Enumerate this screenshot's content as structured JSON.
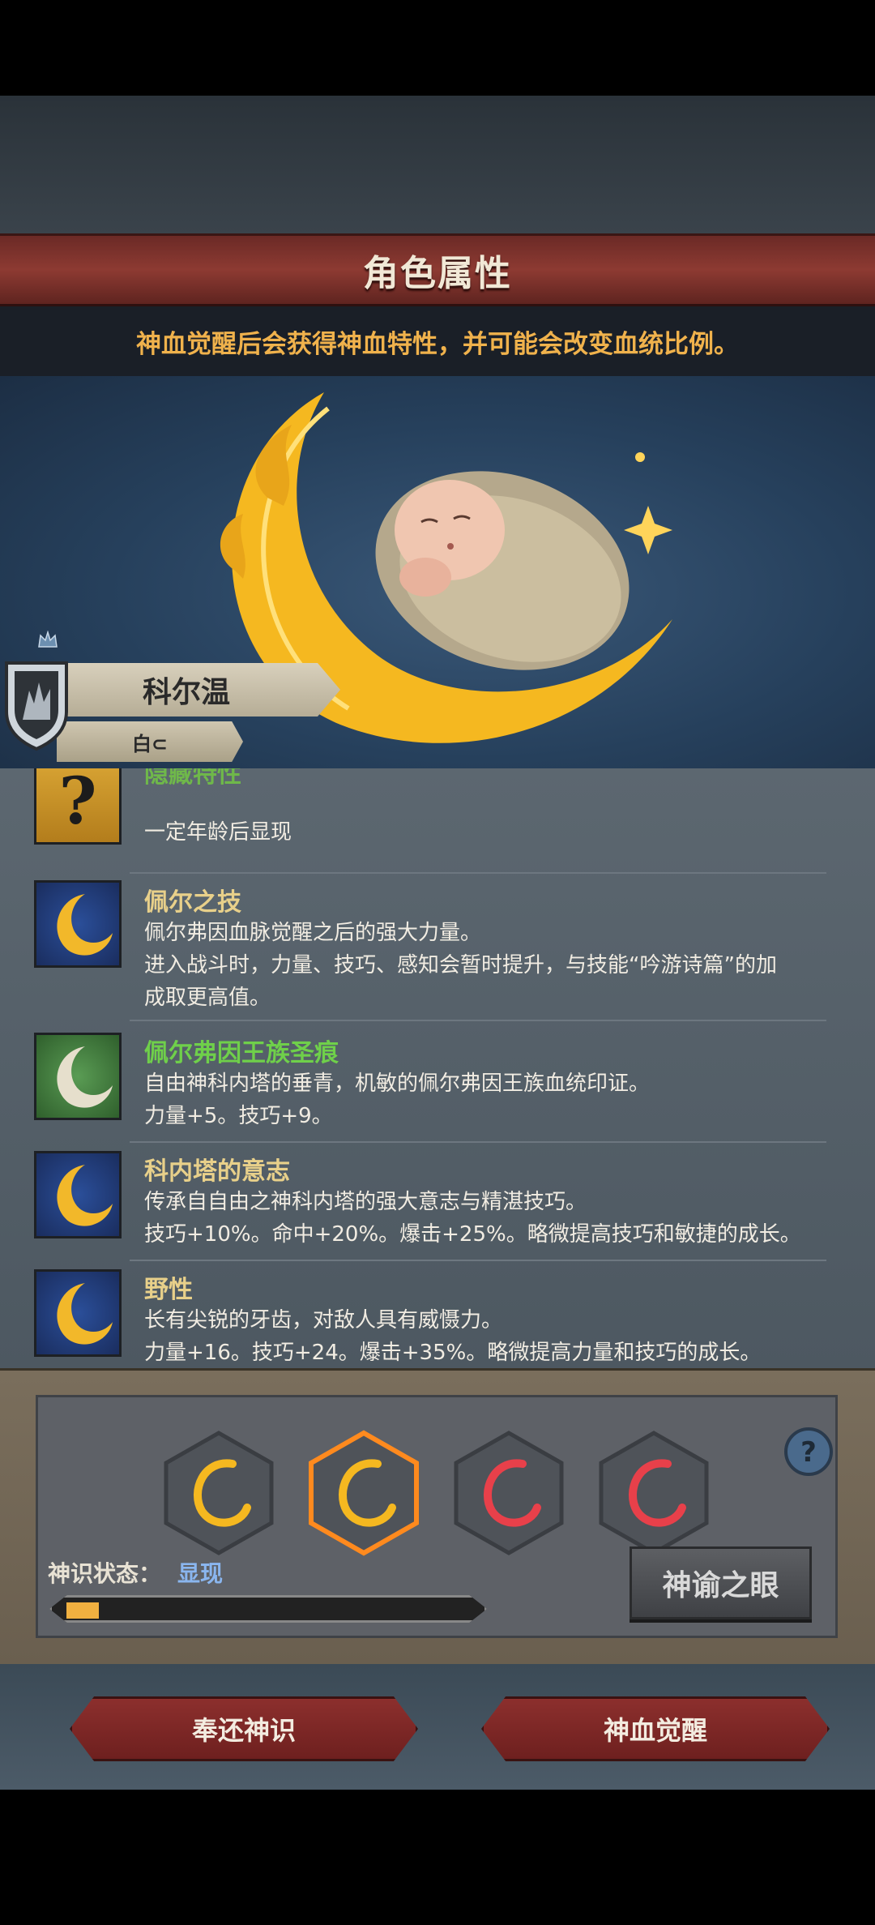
{
  "header": {
    "title": "角色属性"
  },
  "notice": "神血觉醒后会获得神血特性，并可能会改变血统比例。",
  "character": {
    "name": "科尔温",
    "clan": "白⊂"
  },
  "traits": [
    {
      "name": "隐藏特性",
      "name_color": "#6fb84a",
      "icon": "question-icon",
      "lines": [
        "一定年龄后显现"
      ]
    },
    {
      "name": "佩尔之技",
      "name_color": "#e8d08a",
      "icon": "moon-icon",
      "lines": [
        "佩尔弗因血脉觉醒之后的强大力量。",
        "进入战斗时，力量、技巧、感知会暂时提升，与技能“吟游诗篇”的加",
        "成取更高值。"
      ]
    },
    {
      "name": "佩尔弗因王族圣痕",
      "name_color": "#6fd04a",
      "icon": "pale-moon-icon",
      "lines": [
        "自由神科内塔的垂青，机敏的佩尔弗因王族血统印证。",
        "力量+5。技巧+9。"
      ]
    },
    {
      "name": "科内塔的意志",
      "name_color": "#e8d08a",
      "icon": "moon-icon",
      "lines": [
        "传承自自由之神科内塔的强大意志与精湛技巧。",
        "技巧+10%。命中+20%。爆击+25%。略微提高技巧和敏捷的成长。"
      ]
    },
    {
      "name": "野性",
      "name_color": "#e8d08a",
      "icon": "moon-icon",
      "lines": [
        "长有尖锐的牙齿，对敌人具有威慑力。",
        "力量+16。技巧+24。爆击+35%。略微提高力量和技巧的成长。"
      ]
    }
  ],
  "gauge": {
    "state_label": "神识状态：",
    "state_value": "显现",
    "progress": 0.08,
    "oracle_button": "神谕之眼",
    "slots": [
      {
        "color": "gold",
        "selected": false
      },
      {
        "color": "gold",
        "selected": true
      },
      {
        "color": "red",
        "selected": false
      },
      {
        "color": "red",
        "selected": false
      }
    ]
  },
  "actions": {
    "return_label": "奉还神识",
    "awaken_label": "神血觉醒"
  },
  "colors": {
    "accent": "#f0b24c",
    "state": "#8ab6ef",
    "button_red": "#8c2f2d"
  }
}
